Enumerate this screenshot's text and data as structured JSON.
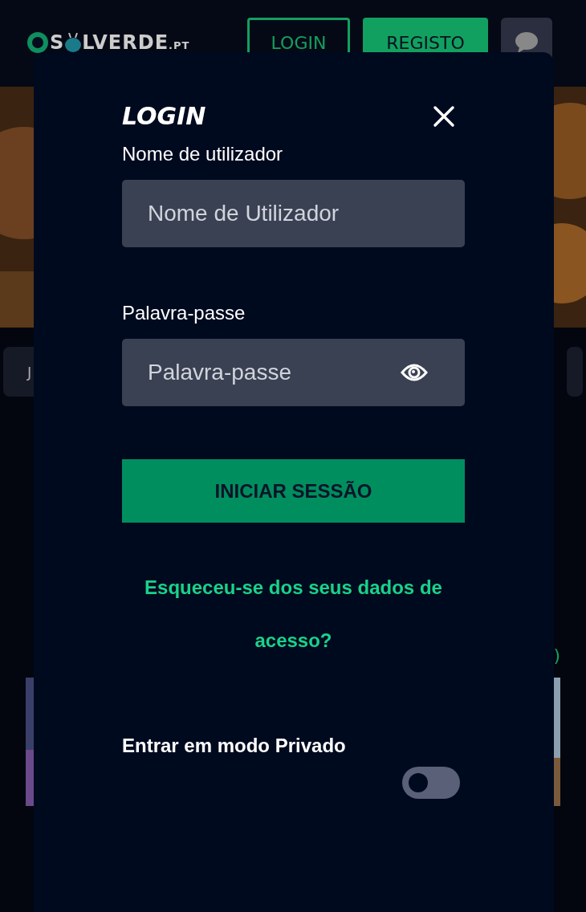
{
  "header": {
    "logo": {
      "first": "S",
      "rest": "LVERDE",
      "suffix": ".PT"
    },
    "buttons": [
      {
        "label": "LOGIN",
        "kind": "outline"
      },
      {
        "label": "REGISTO",
        "kind": "filled"
      }
    ]
  },
  "background": {
    "chip": "J",
    "section2_link": ")"
  },
  "modal": {
    "title": "LOGIN",
    "fields": [
      {
        "label": "Nome de utilizador",
        "placeholder": "Nome de Utilizador",
        "kind": "text"
      },
      {
        "label": "Palavra-passe",
        "placeholder": "Palavra-passe",
        "kind": "password"
      }
    ],
    "submit": "INICIAR SESSÃO",
    "forgot": "Esqueceu-se dos seus dados de acesso?",
    "private_mode": {
      "label": "Entrar em modo Privado",
      "on": false
    }
  }
}
